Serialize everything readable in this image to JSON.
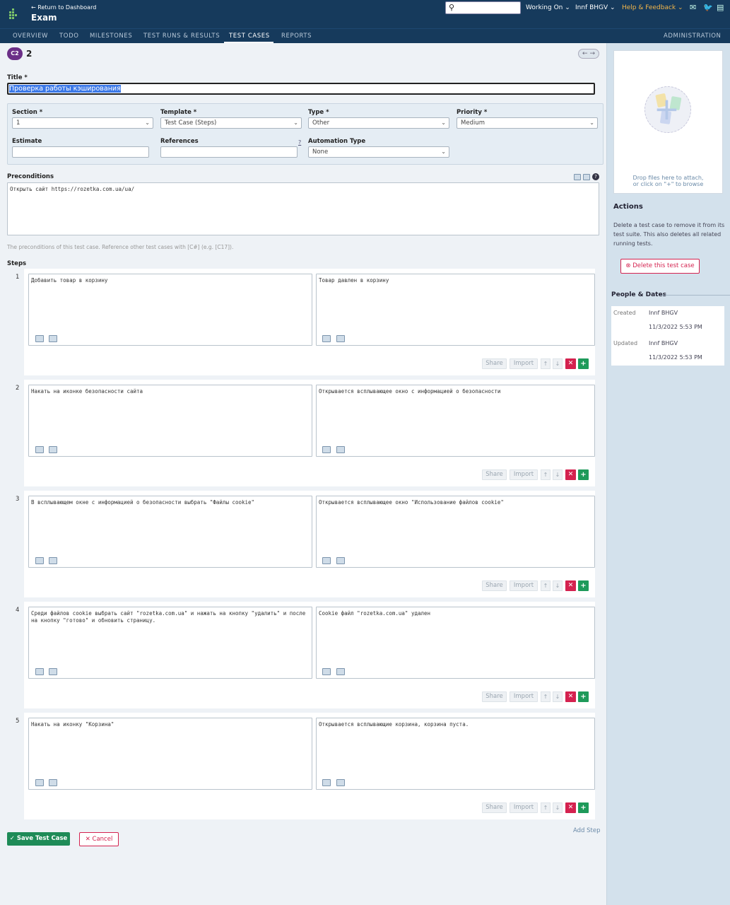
{
  "header": {
    "return_link": "← Return to Dashboard",
    "project": "Exam",
    "search_value": "",
    "working_on": "Working On",
    "user": "Innf BHGV",
    "help": "Help & Feedback"
  },
  "nav": {
    "items": [
      "OVERVIEW",
      "TODO",
      "MILESTONES",
      "TEST RUNS & RESULTS",
      "TEST CASES",
      "REPORTS"
    ],
    "active": "TEST CASES",
    "admin": "ADMINISTRATION"
  },
  "case": {
    "badge": "C2",
    "number": "2",
    "title_label": "Title *",
    "title_value": "Проверка работы кэширования"
  },
  "fields": {
    "section": {
      "label": "Section *",
      "value": "1"
    },
    "template": {
      "label": "Template *",
      "value": "Test Case (Steps)"
    },
    "type": {
      "label": "Type *",
      "value": "Other"
    },
    "priority": {
      "label": "Priority *",
      "value": "Medium"
    },
    "estimate": {
      "label": "Estimate",
      "value": ""
    },
    "references": {
      "label": "References",
      "value": "",
      "help": "?"
    },
    "automation": {
      "label": "Automation Type",
      "value": "None"
    }
  },
  "preconditions": {
    "label": "Preconditions",
    "value": "Открыть сайт  https://rozetka.com.ua/ua/",
    "hint": "The preconditions of this test case. Reference other test cases with [C#] (e.g. [C17])."
  },
  "steps": {
    "label": "Steps",
    "share": "Share",
    "import": "Import",
    "add_step": "Add Step",
    "items": [
      {
        "num": "1",
        "content": "Добавить товар в корзину",
        "expected": "Товар давлен в корзину"
      },
      {
        "num": "2",
        "content": "Накать на иконке безопасности сайта",
        "expected": "Открывается всплывающее окно с информацией о безопасности"
      },
      {
        "num": "3",
        "content": "В всплывающем окне с информацией о безопасности выбрать \"Файлы cookie\"",
        "expected": "Открывается всплывающее окно \"Использование файлов cookie\""
      },
      {
        "num": "4",
        "content": "Среди файлов cookie выбрать сайт \"rozetka.com.ua\" и нажать на кнопку \"удалить\" и после на кнопку \"готово\" и обновить страницу.",
        "expected": "Cookie файл \"rozetka.com.ua\" удален"
      },
      {
        "num": "5",
        "content": "Накать на иконку \"Корзина\"",
        "expected": "Открывается всплывающие корзина, корзина пуста."
      }
    ]
  },
  "buttons": {
    "save": "Save Test Case",
    "cancel": "Cancel"
  },
  "sidebar": {
    "drop_line1": "Drop files here to attach,",
    "drop_line2": "or click on \"+\" to browse",
    "actions_title": "Actions",
    "actions_text": "Delete a test case to remove it from its test suite. This also deletes all related running tests.",
    "delete_button": "Delete this test case",
    "people_title": "People & Dates",
    "created_label": "Created",
    "created_user": "Innf BHGV",
    "created_date": "11/3/2022 5:53 PM",
    "updated_label": "Updated",
    "updated_user": "Innf BHGV",
    "updated_date": "11/3/2022 5:53 PM"
  },
  "colors": {
    "header_bg": "#163a5c",
    "badge": "#6b2f87",
    "danger": "#d4224f",
    "success": "#1e8b57",
    "help": "#f3b64a"
  }
}
